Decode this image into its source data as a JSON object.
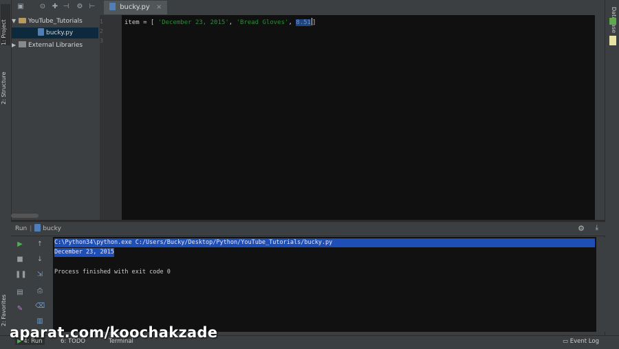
{
  "left_strip": {
    "project_tab": "1: Project",
    "structure_tab": "2: Structure",
    "favorites_tab": "2: Favorites"
  },
  "right_strip": {
    "database_tab": "Database"
  },
  "editor_tabs": [
    {
      "label": "bucky.py"
    }
  ],
  "project_tree": {
    "root": "YouTube_Tutorials",
    "file": "bucky.py",
    "libraries": "External Libraries"
  },
  "gutter": {
    "lines": [
      "1",
      "2",
      "3"
    ]
  },
  "code": {
    "prefix": "item = [ ",
    "str1": "'December 23, 2015'",
    "sep1": ", ",
    "str2": "'Bread Gloves'",
    "sep2": ", ",
    "num": "8.51",
    "suffix": "]"
  },
  "run": {
    "title": "Run",
    "config": "bucky",
    "console": [
      {
        "text": "C:\\Python34\\python.exe C:/Users/Bucky/Desktop/Python/YouTube_Tutorials/bucky.py",
        "highlight": true
      },
      {
        "text": "December 23, 2015",
        "highlight": true
      },
      {
        "text": "",
        "highlight": false
      },
      {
        "text": "Process finished with exit code 0",
        "highlight": false
      }
    ]
  },
  "bottom_bar": {
    "run_tab": "4: Run",
    "todo_tab": "6: TODO",
    "terminal_tab": "Terminal",
    "event_log": "Event Log"
  },
  "watermark": "aparat.com/koochakzade",
  "colors": {
    "editor_bg": "#101010",
    "string": "#2f8c3a",
    "selection": "#214283",
    "console_highlight": "#1e4fb7",
    "run_green": "#4caf50"
  }
}
